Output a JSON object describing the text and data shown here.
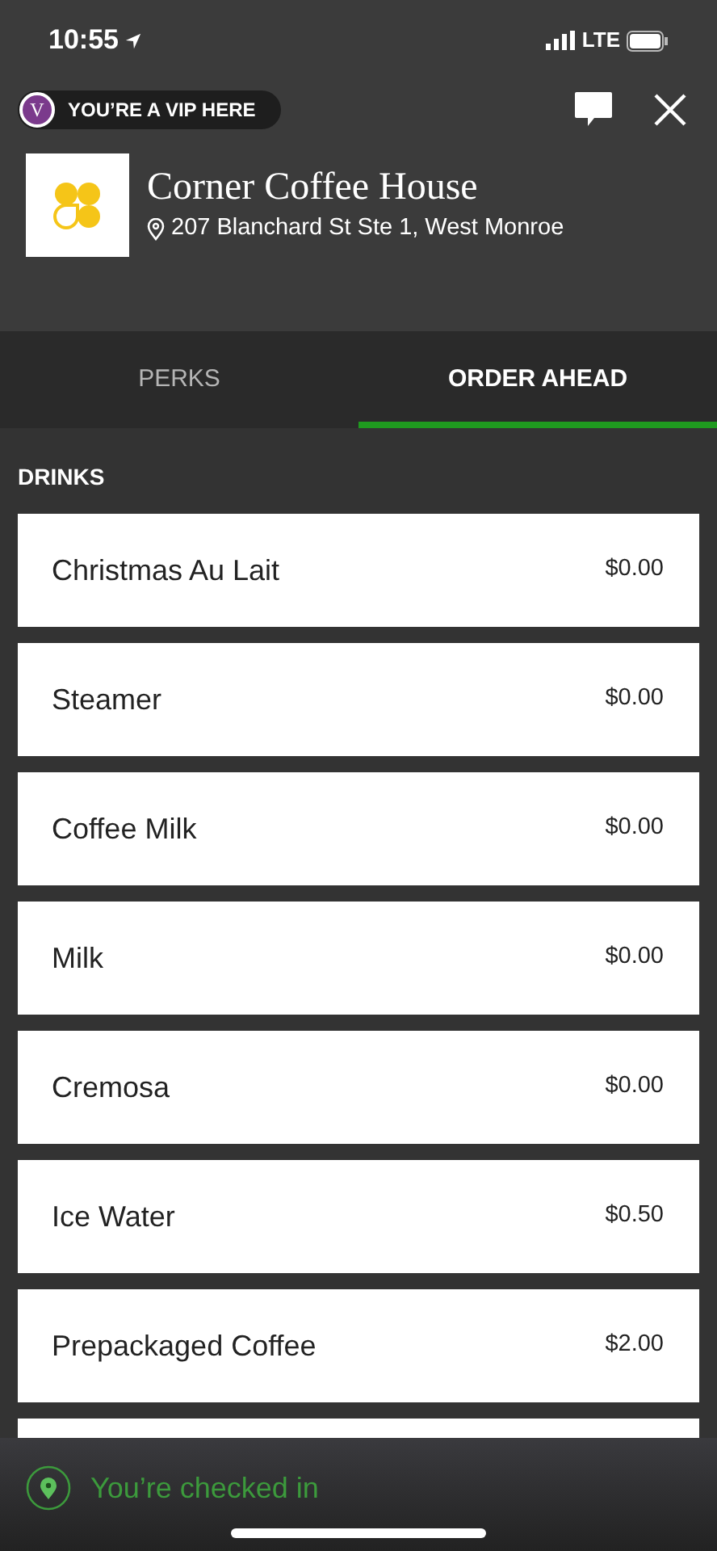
{
  "status_bar": {
    "time": "10:55",
    "network": "LTE"
  },
  "header": {
    "vip_badge": {
      "letter": "V",
      "label": "YOU’RE A VIP HERE"
    },
    "store": {
      "name": "Corner Coffee House",
      "address": "207 Blanchard St Ste 1, West Monroe"
    }
  },
  "tabs": [
    {
      "label": "PERKS",
      "selected": false
    },
    {
      "label": "ORDER AHEAD",
      "selected": true
    }
  ],
  "section": {
    "title": "DRINKS"
  },
  "items": [
    {
      "name": "Christmas Au Lait",
      "price": "$0.00"
    },
    {
      "name": "Steamer",
      "price": "$0.00"
    },
    {
      "name": "Coffee Milk",
      "price": "$0.00"
    },
    {
      "name": "Milk",
      "price": "$0.00"
    },
    {
      "name": "Cremosa",
      "price": "$0.00"
    },
    {
      "name": "Ice Water",
      "price": "$0.50"
    },
    {
      "name": "Prepackaged Coffee",
      "price": "$2.00"
    }
  ],
  "check_in": {
    "label": "You’re checked in"
  }
}
